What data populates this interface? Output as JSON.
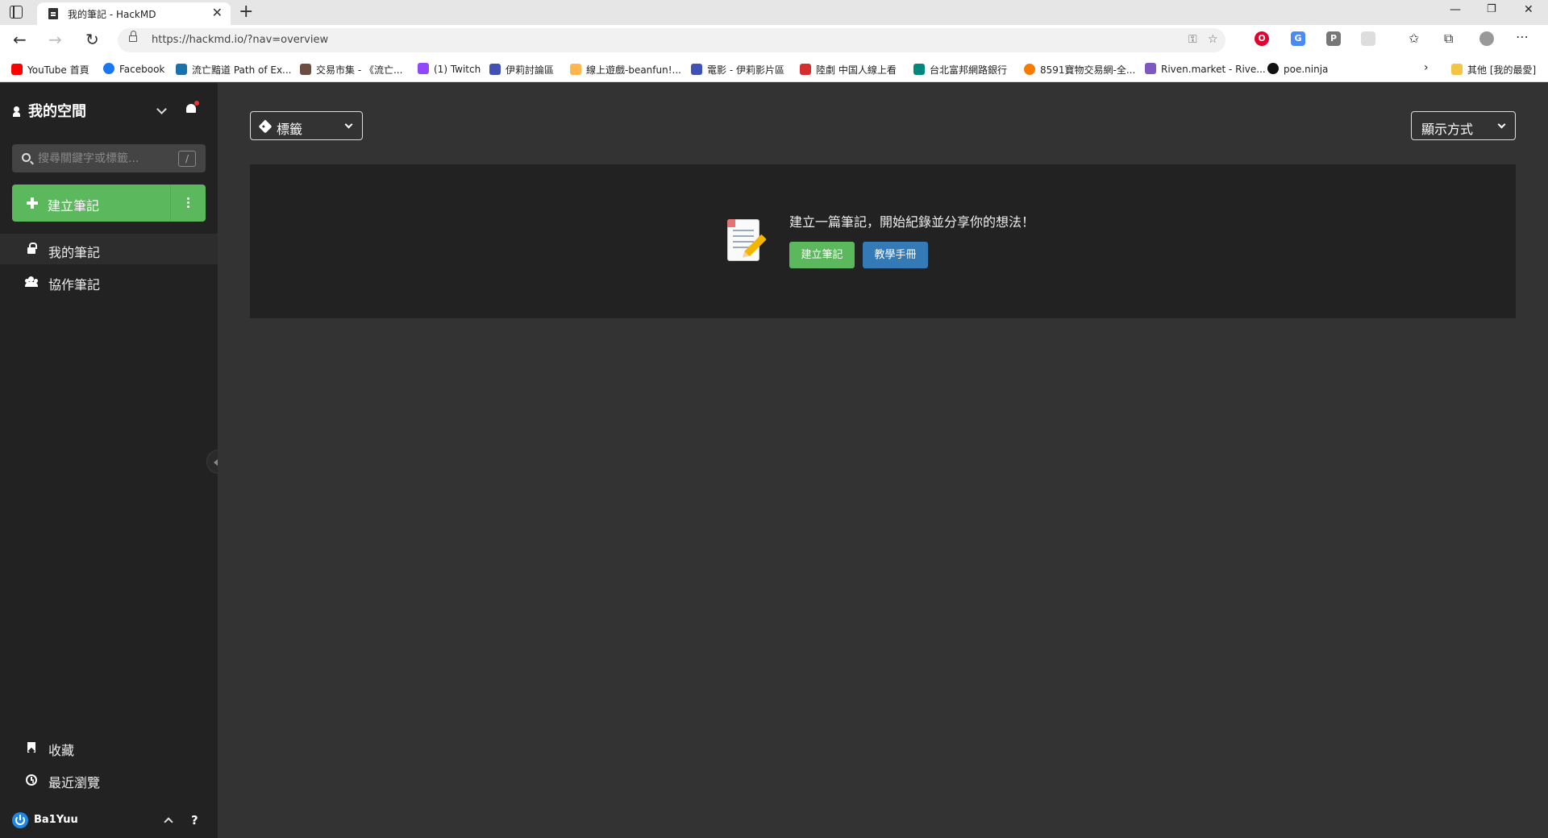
{
  "browser": {
    "tab_title": "我的筆記 - HackMD",
    "url": "https://hackmd.io/?nav=overview",
    "bookmarks": [
      {
        "label": "YouTube 首頁",
        "color": "#ff0000"
      },
      {
        "label": "Facebook",
        "color": "#1877f2"
      },
      {
        "label": "流亡黯道 Path of Ex...",
        "color": "#1a73a8"
      },
      {
        "label": "交易市集 - 《流亡...",
        "color": "#6d4c41"
      },
      {
        "label": "(1) Twitch",
        "color": "#9146ff"
      },
      {
        "label": "伊莉討論區",
        "color": "#3f51b5"
      },
      {
        "label": "線上遊戲-beanfun!...",
        "color": "#ffb74d"
      },
      {
        "label": "電影 - 伊莉影片區",
        "color": "#3f51b5"
      },
      {
        "label": "陸劇 中国人線上看",
        "color": "#d32f2f"
      },
      {
        "label": "台北富邦網路銀行",
        "color": "#00897b"
      },
      {
        "label": "8591寶物交易網-全...",
        "color": "#f57c00"
      },
      {
        "label": "Riven.market - Rive...",
        "color": "#7e57c2"
      },
      {
        "label": "poe.ninja",
        "color": "#111111"
      }
    ],
    "other_bookmarks": "其他 [我的最愛]"
  },
  "sidebar": {
    "space_title": "我的空間",
    "search_placeholder": "搜尋關鍵字或標籤...",
    "search_shortcut": "/",
    "new_note_label": "建立筆記",
    "nav": {
      "my_notes": "我的筆記",
      "team_notes": "協作筆記",
      "favorites": "收藏",
      "recent": "最近瀏覽"
    },
    "username": "Ba1Yuu",
    "help": "?"
  },
  "main": {
    "tag_filter_label": "標籤",
    "display_mode_label": "顯示方式",
    "empty_message": "建立一篇筆記，開始紀錄並分享你的想法！",
    "create_button": "建立筆記",
    "tutorial_button": "教學手冊"
  },
  "colors": {
    "accent_green": "#5cb85c",
    "accent_blue": "#337ab7",
    "sidebar_bg": "#222222",
    "main_bg": "#333333"
  }
}
